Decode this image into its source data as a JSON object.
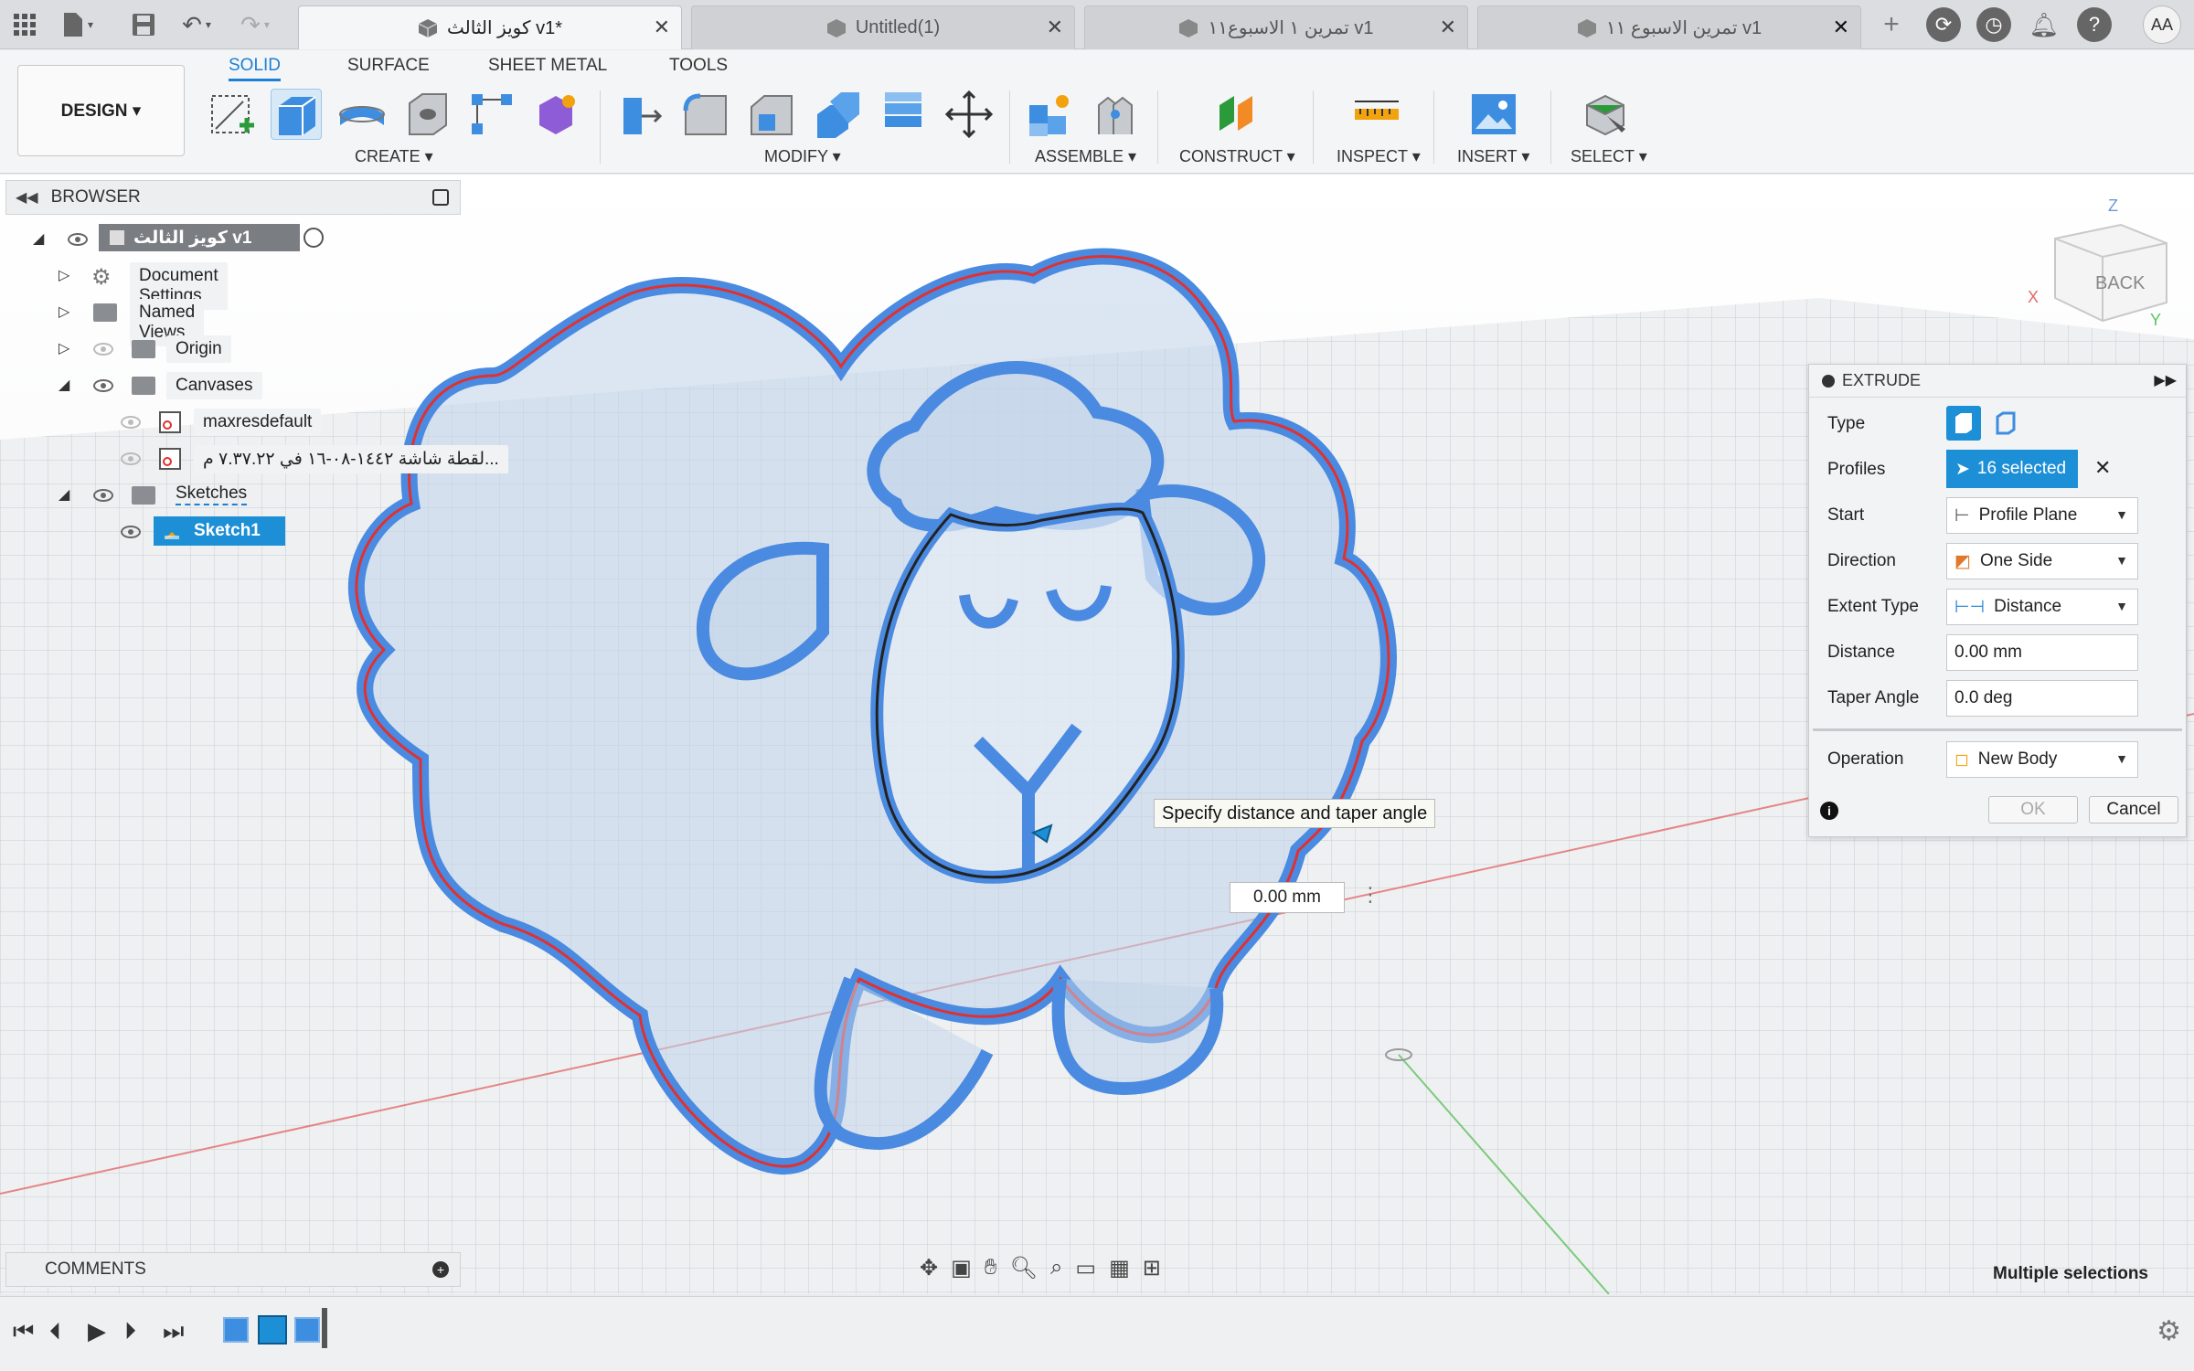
{
  "tabs": [
    {
      "title": "كويز الثالث v1*",
      "active": true
    },
    {
      "title": "Untitled(1)",
      "active": false
    },
    {
      "title": "تمرين ١ الاسبوع١١ v1",
      "active": false
    },
    {
      "title": "تمرين الاسبوع ١١ v1",
      "active": false
    }
  ],
  "user_initials": "AA",
  "ribbon": {
    "workspace": "DESIGN ▾",
    "tabs": [
      "SOLID",
      "SURFACE",
      "SHEET METAL",
      "TOOLS"
    ],
    "groups": [
      "CREATE ▾",
      "MODIFY ▾",
      "ASSEMBLE ▾",
      "CONSTRUCT ▾",
      "INSPECT ▾",
      "INSERT ▾",
      "SELECT ▾"
    ]
  },
  "browser": {
    "title": "BROWSER",
    "root": "كويز الثالث v1",
    "items": {
      "document_settings": "Document Settings",
      "named_views": "Named Views",
      "origin": "Origin",
      "canvases": "Canvases",
      "canvas1": "maxresdefault",
      "canvas2": "...لقطة شاشة ١٤٤٢-٠٨-١٦ في ٧.٣٧.٢٢ م",
      "sketches": "Sketches",
      "sketch1": "Sketch1"
    }
  },
  "comments_label": "COMMENTS",
  "viewcube_label": "BACK",
  "tooltip": "Specify distance and taper angle",
  "distance_input": "0.00 mm",
  "extrude": {
    "title": "EXTRUDE",
    "type_label": "Type",
    "profiles_label": "Profiles",
    "profiles_value": "16 selected",
    "start_label": "Start",
    "start_value": "Profile Plane",
    "direction_label": "Direction",
    "direction_value": "One Side",
    "extent_label": "Extent Type",
    "extent_value": "Distance",
    "distance_label": "Distance",
    "distance_value": "0.00 mm",
    "taper_label": "Taper Angle",
    "taper_value": "0.0 deg",
    "operation_label": "Operation",
    "operation_value": "New Body",
    "ok": "OK",
    "cancel": "Cancel"
  },
  "status": "Multiple selections",
  "colors": {
    "accent": "#1d7fd6",
    "sketch_blue": "#3d85e0",
    "profile_red": "#e03131"
  }
}
